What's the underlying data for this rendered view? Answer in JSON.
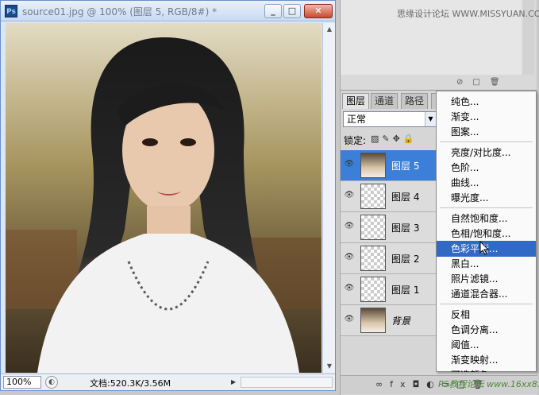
{
  "document": {
    "title": "source01.jpg @ 100% (图层 5, RGB/8#) *",
    "zoom": "100%",
    "doc_size": "文档:520.3K/3.56M"
  },
  "top_panel": {
    "watermark": "思缘设计论坛 WWW.MISSYUAN.COM"
  },
  "layers_panel": {
    "tabs": [
      "图层",
      "通道",
      "路径",
      ""
    ],
    "blend_mode": "正常",
    "lock_label": "锁定:",
    "layers": [
      {
        "name": "图层 5",
        "selected": true
      },
      {
        "name": "图层 4",
        "selected": false
      },
      {
        "name": "图层 3",
        "selected": false
      },
      {
        "name": "图层 2",
        "selected": false
      },
      {
        "name": "图层 1",
        "selected": false
      },
      {
        "name": "背景",
        "selected": false
      }
    ]
  },
  "menu": {
    "items": [
      "纯色...",
      "渐变...",
      "图案...",
      "亮度/对比度...",
      "色阶...",
      "曲线...",
      "曝光度...",
      "自然饱和度...",
      "色相/饱和度...",
      "色彩平衡...",
      "黑白...",
      "照片滤镜...",
      "通道混合器...",
      "反相",
      "色调分离...",
      "阈值...",
      "渐变映射...",
      "可选颜色..."
    ],
    "highlighted": "色彩平衡..."
  },
  "watermark_bottom": "PS教程论坛 www.16xx8.com"
}
